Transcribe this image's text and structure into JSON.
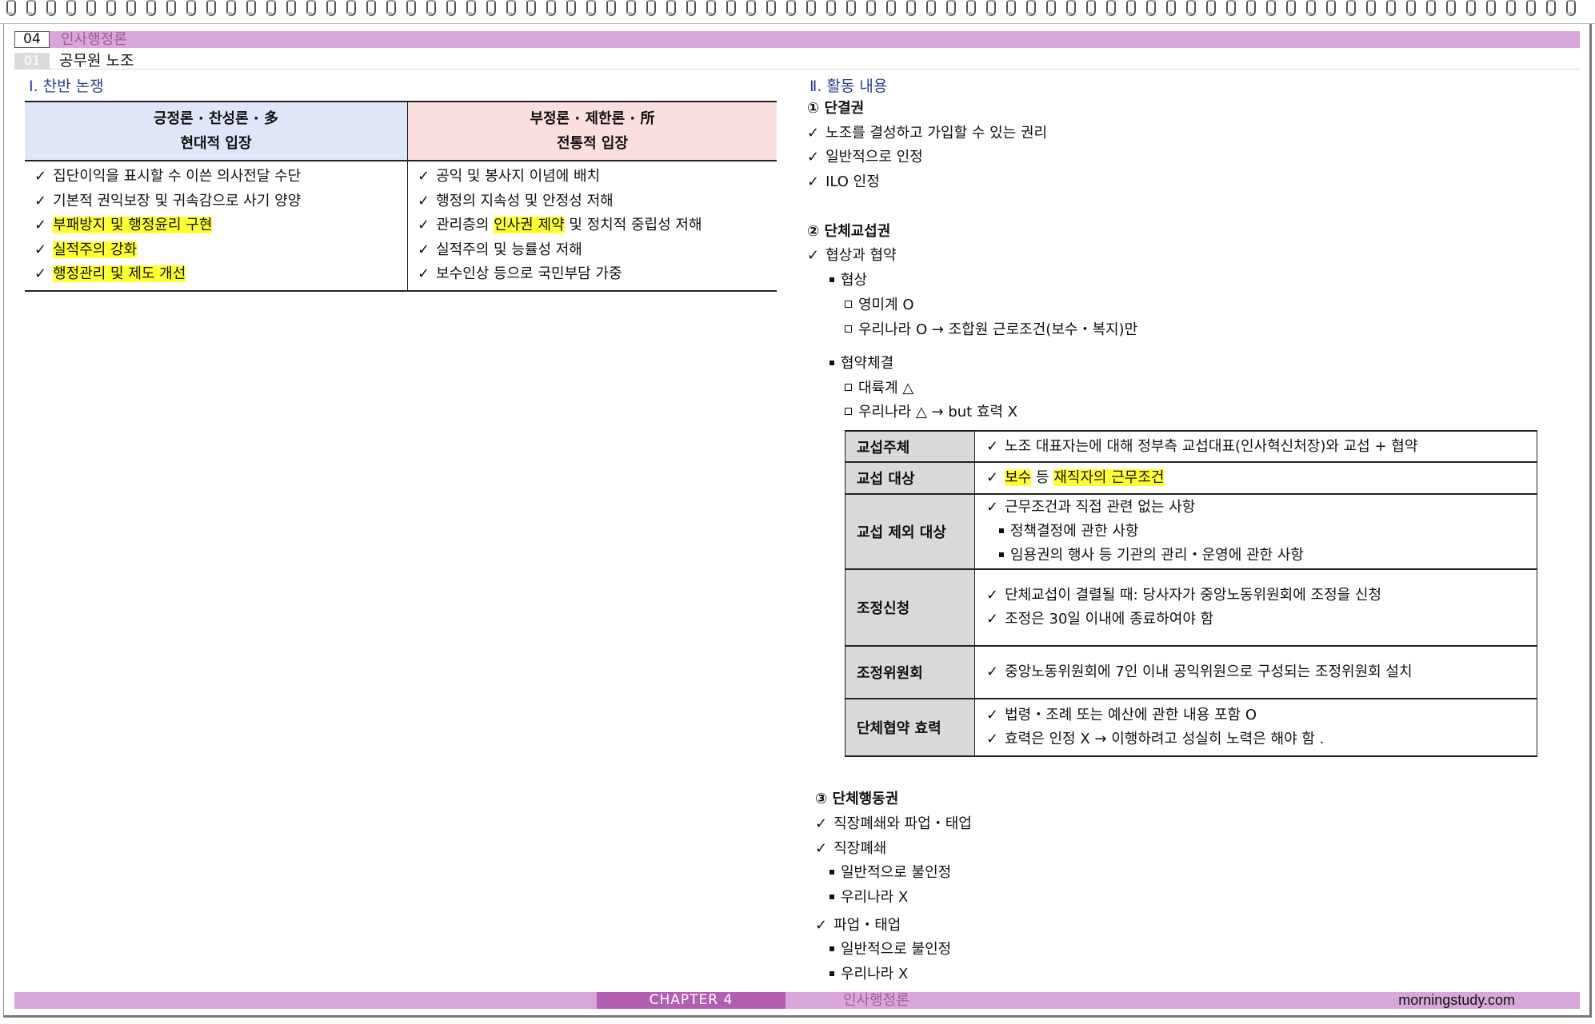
{
  "header": {
    "chapter_num": "04",
    "chapter_title": "인사행정론",
    "section_num": "01",
    "section_title": "공무원 노조"
  },
  "debate": {
    "heading": "Ⅰ. 찬반 논쟁",
    "positive": {
      "title": "긍정론 · 찬성론 · 多",
      "subtitle": "현대적 입장",
      "items": [
        [
          "집단이익을 표시할 수 이쓴 의사전달 수단",
          ""
        ],
        [
          "기본적 권익보장 및 귀속감으로 사기 양양",
          ""
        ],
        [
          "",
          "부패방지 및 행정윤리 구현"
        ],
        [
          "",
          "실적주의 강화"
        ],
        [
          "",
          "행정관리 및 제도 개선"
        ]
      ]
    },
    "negative": {
      "title": "부정론 ·  제한론 · 所",
      "subtitle": "전통적 입장",
      "items": [
        [
          "공익 및 봉사지 이념에 배치",
          "",
          ""
        ],
        [
          "행정의 지속성 및 안정성 저해",
          "",
          ""
        ],
        [
          "관리층의 ",
          "인사권 제약",
          " 및 정치적 중립성 저해"
        ],
        [
          "실적주의 및 능률성 저해",
          "",
          ""
        ],
        [
          "보수인상 등으로 국민부담 가중",
          "",
          ""
        ]
      ]
    }
  },
  "activities": {
    "heading": "Ⅱ. 활동 내용",
    "right1": {
      "title": "① 단결권",
      "items": [
        "노조를 결성하고 가입할 수 있는 권리",
        "일반적으로 인정",
        "ILO 인정"
      ]
    },
    "right2": {
      "title": "② 단체교섭권",
      "item": "협상과 협약",
      "sub1": "협상",
      "sub1_items": [
        "영미계 O",
        "우리나라 O → 조합원 근로조건(보수・복지)만"
      ],
      "sub2": "협약체결",
      "sub2_items": [
        "대륙계 △",
        "우리나라 △ →  but 효력 X"
      ]
    },
    "table": {
      "rows": [
        {
          "key": "교섭주체",
          "lines": [
            "노조 대표자는에 대해 정부측 교섭대표(인사혁신처장)와 교섭 + 협약"
          ]
        },
        {
          "key": "교섭 대상",
          "pre": "",
          "hl1": "보수",
          "mid": " 등 ",
          "hl2": "재직자의 근무조건"
        },
        {
          "key": "교섭 제외 대상",
          "lines": [
            "근무조건과 직접 관련 없는 사항"
          ],
          "subs": [
            "정책결정에 관한 사항",
            "임용권의 행사 등 기관의 관리・운영에 관한 사항"
          ]
        },
        {
          "key": "조정신청",
          "lines": [
            "단체교섭이 결렬될 때: 당사자가 중앙노동위원회에 조정을 신청",
            "조정은 30일 이내에 종료하여야 함"
          ]
        },
        {
          "key": "조정위원회",
          "lines": [
            "중앙노동위원회에 7인 이내 공익위원으로 구성되는 조정위원회 설치"
          ]
        },
        {
          "key": "단체협약 효력",
          "lines": [
            "법령・조례 또는 예산에 관한 내용 포함 O",
            "효력은 인정 X → 이행하려고 성실히 노력은 해야 함 ."
          ]
        }
      ]
    },
    "right3": {
      "title": "③ 단체행동권",
      "item1": "직장폐쇄와 파업・태업",
      "item2": "직장폐쇄",
      "item2_subs": [
        "일반적으로 불인정",
        "우리나라 X"
      ],
      "item3": "파업・태업",
      "item3_subs": [
        "일반적으로 불인정",
        "우리나라 X"
      ]
    }
  },
  "footer": {
    "chapter": "CHAPTER 4",
    "book": "인사행정론",
    "site": "morningstudy.com"
  },
  "check": "✓"
}
